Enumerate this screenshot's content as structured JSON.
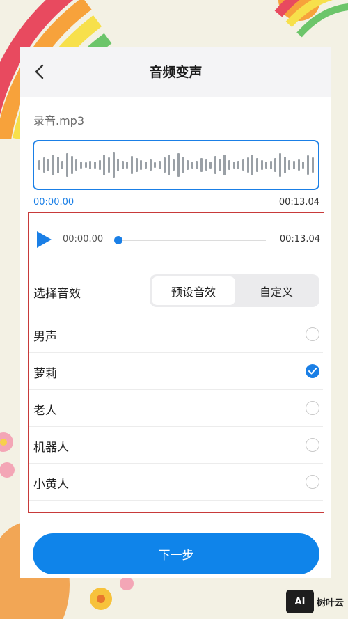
{
  "header": {
    "title": "音频变声",
    "back_icon": "chevron-left-icon"
  },
  "file": {
    "name": "录音.mp3"
  },
  "waveform": {
    "start_time": "00:00.00",
    "end_time": "00:13.04"
  },
  "player": {
    "current_time": "00:00.00",
    "end_time": "00:13.04",
    "progress": 0,
    "play_icon": "play-icon"
  },
  "effects": {
    "label": "选择音效",
    "tabs": [
      {
        "label": "预设音效",
        "active": true
      },
      {
        "label": "自定义",
        "active": false
      }
    ],
    "options": [
      {
        "label": "男声",
        "checked": false
      },
      {
        "label": "萝莉",
        "checked": true
      },
      {
        "label": "老人",
        "checked": false
      },
      {
        "label": "机器人",
        "checked": false
      },
      {
        "label": "小黄人",
        "checked": false
      }
    ]
  },
  "next_button": {
    "label": "下一步"
  },
  "watermark": {
    "badge": "AI",
    "text": "树叶云"
  },
  "colors": {
    "accent": "#1a7fe6",
    "button": "#0f84ea",
    "highlight_border": "#c83a3a"
  }
}
